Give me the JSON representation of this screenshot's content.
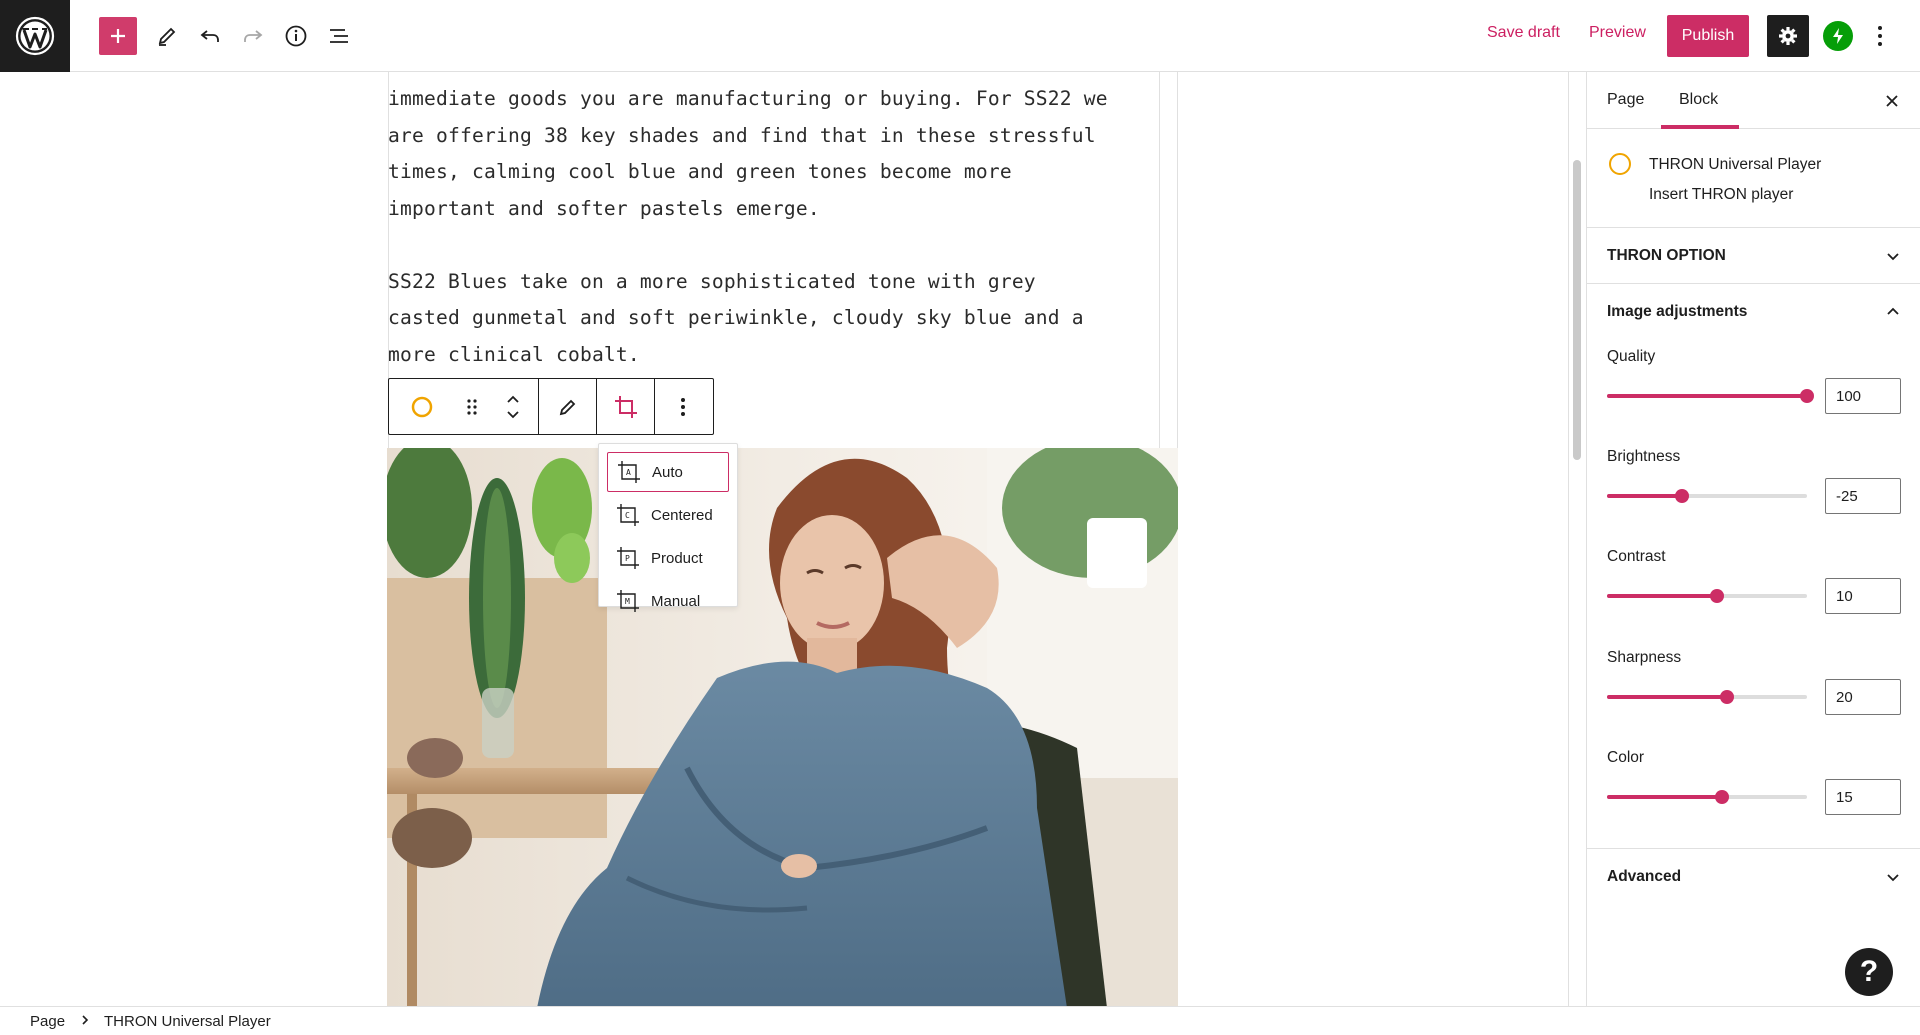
{
  "topbar": {
    "save_draft": "Save draft",
    "preview": "Preview",
    "publish": "Publish"
  },
  "content": {
    "lines": [
      "immediate goods you are manufacturing or buying. For SS22 we",
      "are offering 38 key shades and find that in these stressful",
      "times, calming cool blue and green tones become more",
      "important and softer pastels emerge.",
      "",
      "SS22 Blues take on a more sophisticated tone with grey",
      "casted gunmetal and soft periwinkle, cloudy sky blue and a",
      "more clinical cobalt."
    ]
  },
  "crop_menu": {
    "items": [
      {
        "icon_letter": "A",
        "label": "Auto",
        "selected": true
      },
      {
        "icon_letter": "C",
        "label": "Centered",
        "selected": false
      },
      {
        "icon_letter": "P",
        "label": "Product",
        "selected": false
      },
      {
        "icon_letter": "M",
        "label": "Manual",
        "selected": false
      }
    ]
  },
  "sidebar": {
    "tabs": {
      "page": "Page",
      "block": "Block"
    },
    "block": {
      "title": "THRON Universal Player",
      "description": "Insert THRON player"
    },
    "panels": {
      "thron_option": "THRON OPTION",
      "image_adjustments": "Image adjustments",
      "advanced": "Advanced"
    },
    "sliders": [
      {
        "label": "Quality",
        "value": "100",
        "fraction": 1.0
      },
      {
        "label": "Brightness",
        "value": "-25",
        "fraction": 0.375
      },
      {
        "label": "Contrast",
        "value": "10",
        "fraction": 0.55
      },
      {
        "label": "Sharpness",
        "value": "20",
        "fraction": 0.6
      },
      {
        "label": "Color",
        "value": "15",
        "fraction": 0.575
      }
    ],
    "help": "?"
  },
  "breadcrumb": {
    "root": "Page",
    "current": "THRON Universal Player"
  },
  "colors": {
    "accent": "#cc2d65",
    "thron_ring": "#f0a400",
    "jetpack": "#069e08"
  }
}
